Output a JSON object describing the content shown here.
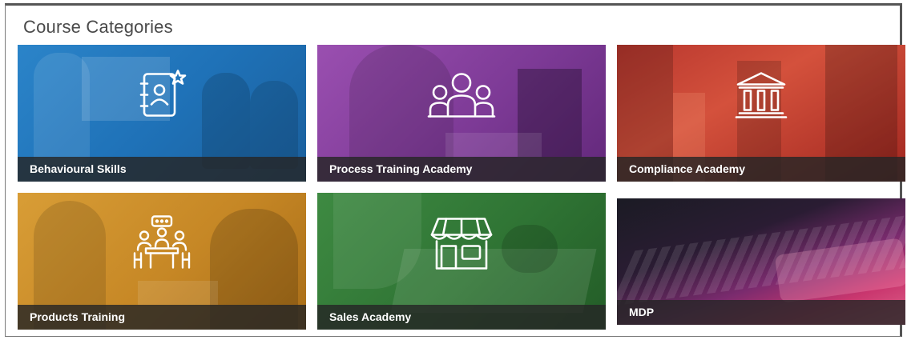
{
  "page": {
    "title": "Course Categories"
  },
  "categories": [
    {
      "label": "Behavioural Skills",
      "icon": "contact-book-star-icon",
      "color": "#1f72b8"
    },
    {
      "label": "Process Training Academy",
      "icon": "team-group-icon",
      "color": "#7d3a96"
    },
    {
      "label": "Compliance Academy",
      "icon": "bank-building-icon",
      "color": "#c2402f"
    },
    {
      "label": "Products Training",
      "icon": "meeting-table-icon",
      "color": "#c68725"
    },
    {
      "label": "Sales Academy",
      "icon": "storefront-icon",
      "color": "#2f7434"
    },
    {
      "label": "MDP",
      "icon": "",
      "color": "#c9366e"
    }
  ]
}
